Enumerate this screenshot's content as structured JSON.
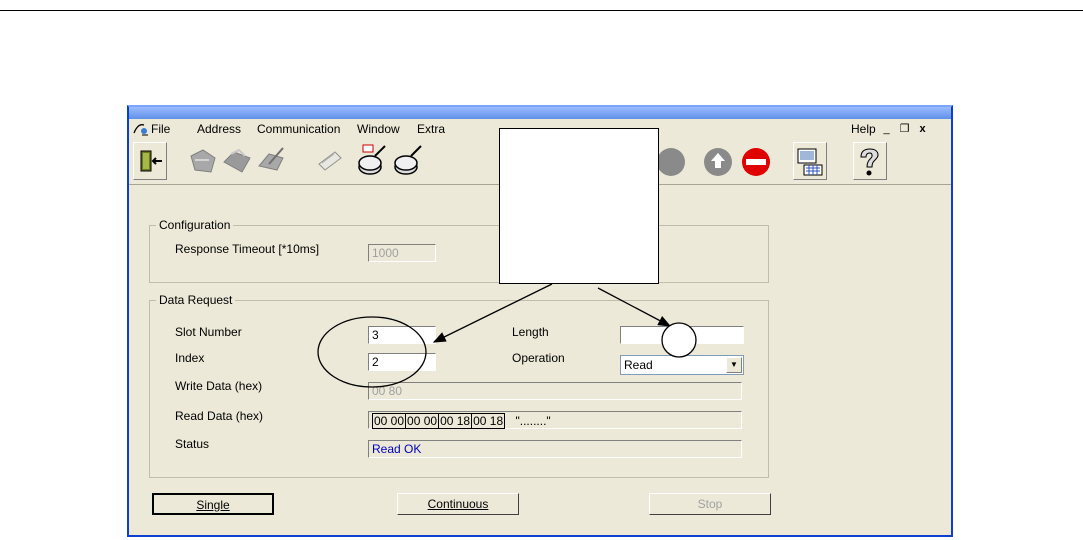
{
  "menu": {
    "file": "File",
    "address": "Address",
    "communication": "Communication",
    "window": "Window",
    "extra": "Extra",
    "help": "Help"
  },
  "window_controls": {
    "minimize": "_",
    "restore": "❐",
    "close": "x"
  },
  "toolbar_icons": [
    "exit-icon",
    "read-icon",
    "write-icon",
    "edit-icon",
    "message-icon",
    "search-icon",
    "find-icon",
    "hidden",
    "hidden",
    "hidden",
    "up-icon",
    "stop-icon",
    "network-icon",
    "help-icon"
  ],
  "configuration": {
    "title": "Configuration",
    "timeout_label": "Response Timeout [*10ms]",
    "timeout_value": "1000"
  },
  "data_request": {
    "title": "Data Request",
    "slot_label": "Slot Number",
    "slot_value": "3",
    "index_label": "Index",
    "index_value": "2",
    "length_label": "Length",
    "length_value": "",
    "operation_label": "Operation",
    "operation_value": "Read",
    "write_label": "Write Data (hex)",
    "write_value": "00 80",
    "read_label": "Read Data (hex)",
    "read_cells": [
      "00 00",
      "00 00",
      "00 18",
      "00 18"
    ],
    "read_ascii": "\"........\"",
    "status_label": "Status",
    "status_value": "Read OK"
  },
  "buttons": {
    "single": "Single",
    "continuous": "Continuous",
    "stop": "Stop"
  },
  "colors": {
    "accent": "#0a3fd0",
    "status_text": "#0000c0",
    "face": "#ece9d8"
  }
}
